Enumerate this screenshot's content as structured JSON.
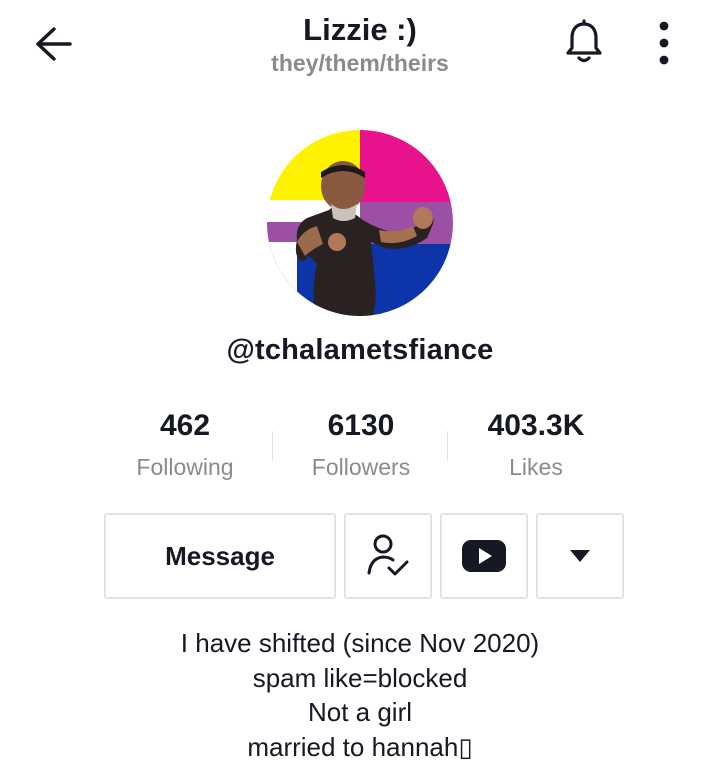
{
  "header": {
    "display_name": "Lizzie :)",
    "pronouns": "they/them/theirs",
    "icons": {
      "back": "arrow-left-icon",
      "bell": "bell-icon",
      "more": "more-vertical-icon"
    }
  },
  "profile": {
    "username": "@tchalametsfiance",
    "avatar_flag_colors": [
      "#fff200",
      "#e8128c",
      "#9b4fa5",
      "#0d34a8"
    ]
  },
  "stats": [
    {
      "value": "462",
      "label": "Following"
    },
    {
      "value": "6130",
      "label": "Followers"
    },
    {
      "value": "403.3K",
      "label": "Likes"
    }
  ],
  "actions": {
    "message_label": "Message",
    "friend_icon": "user-check-icon",
    "youtube_icon": "youtube-icon",
    "dropdown_icon": "triangle-down-icon"
  },
  "bio": {
    "lines": [
      "I have shifted (since Nov 2020)",
      "spam like=blocked",
      "Not a girl",
      "married to hannah▯"
    ]
  }
}
